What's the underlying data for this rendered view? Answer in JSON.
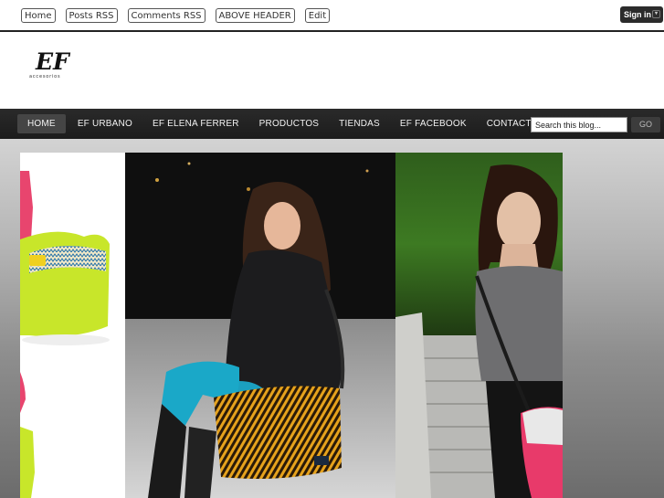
{
  "top_links": [
    "Home",
    "Posts RSS",
    "Comments RSS",
    "ABOVE HEADER",
    "Edit"
  ],
  "signin": {
    "label": "Sign in"
  },
  "logo": {
    "text": "EF",
    "subtext": "accesorios",
    "color": "#111111"
  },
  "nav": {
    "items": [
      "HOME",
      "EF URBANO",
      "EF ELENA FERRER",
      "PRODUCTOS",
      "TIENDAS",
      "EF FACEBOOK",
      "CONTACTO"
    ],
    "active_index": 0,
    "background": "#222222"
  },
  "search": {
    "value": "Search this blog...",
    "go_label": "GO"
  },
  "colors": {
    "accent_bag_green": "#c8e62a",
    "accent_bag_pink": "#e83a6a",
    "skirt_orange": "#e08a1a"
  }
}
